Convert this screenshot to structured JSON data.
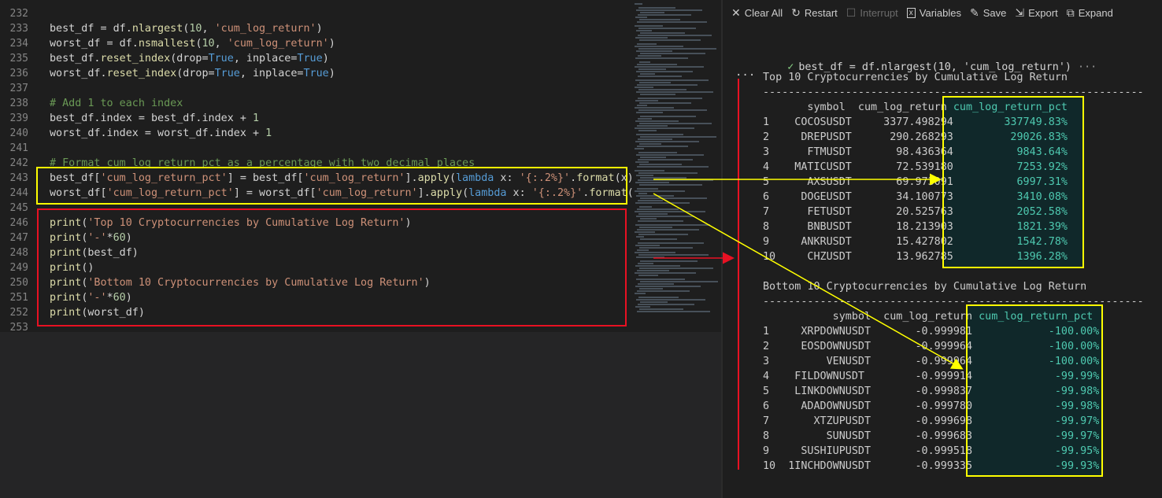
{
  "editor": {
    "line_numbers": [
      "232",
      "233",
      "234",
      "235",
      "236",
      "237",
      "238",
      "239",
      "240",
      "241",
      "242",
      "243",
      "244",
      "245",
      "246",
      "247",
      "248",
      "249",
      "250",
      "251",
      "252",
      "253"
    ],
    "lines": [
      [],
      [
        {
          "t": "best_df = df.",
          "c": ""
        },
        {
          "t": "nlargest",
          "c": "fn"
        },
        {
          "t": "(",
          "c": ""
        },
        {
          "t": "10",
          "c": "num"
        },
        {
          "t": ", ",
          "c": ""
        },
        {
          "t": "'cum_log_return'",
          "c": "str"
        },
        {
          "t": ")",
          "c": ""
        }
      ],
      [
        {
          "t": "worst_df = df.",
          "c": ""
        },
        {
          "t": "nsmallest",
          "c": "fn"
        },
        {
          "t": "(",
          "c": ""
        },
        {
          "t": "10",
          "c": "num"
        },
        {
          "t": ", ",
          "c": ""
        },
        {
          "t": "'cum_log_return'",
          "c": "str"
        },
        {
          "t": ")",
          "c": ""
        }
      ],
      [
        {
          "t": "best_df.",
          "c": ""
        },
        {
          "t": "reset_index",
          "c": "fn"
        },
        {
          "t": "(drop=",
          "c": ""
        },
        {
          "t": "True",
          "c": "kw"
        },
        {
          "t": ", inplace=",
          "c": ""
        },
        {
          "t": "True",
          "c": "kw"
        },
        {
          "t": ")",
          "c": ""
        }
      ],
      [
        {
          "t": "worst_df.",
          "c": ""
        },
        {
          "t": "reset_index",
          "c": "fn"
        },
        {
          "t": "(drop=",
          "c": ""
        },
        {
          "t": "True",
          "c": "kw"
        },
        {
          "t": ", inplace=",
          "c": ""
        },
        {
          "t": "True",
          "c": "kw"
        },
        {
          "t": ")",
          "c": ""
        }
      ],
      [],
      [
        {
          "t": "# Add 1 to each index",
          "c": "cm"
        }
      ],
      [
        {
          "t": "best_df.index = best_df.index + ",
          "c": ""
        },
        {
          "t": "1",
          "c": "num"
        }
      ],
      [
        {
          "t": "worst_df.index = worst_df.index + ",
          "c": ""
        },
        {
          "t": "1",
          "c": "num"
        }
      ],
      [],
      [
        {
          "t": "# Format cum_log_return_pct as a percentage with two decimal places",
          "c": "cm"
        }
      ],
      [
        {
          "t": "best_df[",
          "c": ""
        },
        {
          "t": "'cum_log_return_pct'",
          "c": "str"
        },
        {
          "t": "] = best_df[",
          "c": ""
        },
        {
          "t": "'cum_log_return'",
          "c": "str"
        },
        {
          "t": "].",
          "c": ""
        },
        {
          "t": "apply",
          "c": "fn"
        },
        {
          "t": "(",
          "c": ""
        },
        {
          "t": "lambda",
          "c": "kw"
        },
        {
          "t": " x: ",
          "c": ""
        },
        {
          "t": "'{:.2%}'",
          "c": "str"
        },
        {
          "t": ".",
          "c": ""
        },
        {
          "t": "format",
          "c": "fn"
        },
        {
          "t": "(x))",
          "c": ""
        }
      ],
      [
        {
          "t": "worst_df[",
          "c": ""
        },
        {
          "t": "'cum_log_return_pct'",
          "c": "str"
        },
        {
          "t": "] = worst_df[",
          "c": ""
        },
        {
          "t": "'cum_log_return'",
          "c": "str"
        },
        {
          "t": "].",
          "c": ""
        },
        {
          "t": "apply",
          "c": "fn"
        },
        {
          "t": "(",
          "c": ""
        },
        {
          "t": "lambda",
          "c": "kw"
        },
        {
          "t": " x: ",
          "c": ""
        },
        {
          "t": "'{:.2%}'",
          "c": "str"
        },
        {
          "t": ".",
          "c": ""
        },
        {
          "t": "format",
          "c": "fn"
        },
        {
          "t": "(x))",
          "c": ""
        }
      ],
      [],
      [
        {
          "t": "print",
          "c": "fn"
        },
        {
          "t": "(",
          "c": ""
        },
        {
          "t": "'Top 10 Cryptocurrencies by Cumulative Log Return'",
          "c": "str"
        },
        {
          "t": ")",
          "c": ""
        }
      ],
      [
        {
          "t": "print",
          "c": "fn"
        },
        {
          "t": "(",
          "c": ""
        },
        {
          "t": "'-'",
          "c": "str"
        },
        {
          "t": "*",
          "c": ""
        },
        {
          "t": "60",
          "c": "num"
        },
        {
          "t": ")",
          "c": ""
        }
      ],
      [
        {
          "t": "print",
          "c": "fn"
        },
        {
          "t": "(best_df)",
          "c": ""
        }
      ],
      [
        {
          "t": "print",
          "c": "fn"
        },
        {
          "t": "()",
          "c": ""
        }
      ],
      [
        {
          "t": "print",
          "c": "fn"
        },
        {
          "t": "(",
          "c": ""
        },
        {
          "t": "'Bottom 10 Cryptocurrencies by Cumulative Log Return'",
          "c": "str"
        },
        {
          "t": ")",
          "c": ""
        }
      ],
      [
        {
          "t": "print",
          "c": "fn"
        },
        {
          "t": "(",
          "c": ""
        },
        {
          "t": "'-'",
          "c": "str"
        },
        {
          "t": "*",
          "c": ""
        },
        {
          "t": "60",
          "c": "num"
        },
        {
          "t": ")",
          "c": ""
        }
      ],
      [
        {
          "t": "print",
          "c": "fn"
        },
        {
          "t": "(worst_df)",
          "c": ""
        }
      ],
      []
    ]
  },
  "toolbar": {
    "clear_all": "Clear All",
    "restart": "Restart",
    "interrupt": "Interrupt",
    "variables": "Variables",
    "save": "Save",
    "export": "Export",
    "expand": "Expand"
  },
  "output": {
    "cell_code": "best_df = df.nlargest(10, 'cum_log_return')",
    "cell_more": "···",
    "collapse": "···",
    "top_title": "Top 10 Cryptocurrencies by Cumulative Log Return",
    "separator": "------------------------------------------------------------",
    "top_header": "       symbol  cum_log_return ",
    "top_pct_header": "cum_log_return_pct",
    "top_rows": [
      {
        "left": "1    COCOSUSDT     3377.498294 ",
        "pct": "       337749.83%"
      },
      {
        "left": "2     DREPUSDT      290.268293 ",
        "pct": "        29026.83%"
      },
      {
        "left": "3      FTMUSDT       98.436364 ",
        "pct": "         9843.64%"
      },
      {
        "left": "4    MATICUSDT       72.539180 ",
        "pct": "         7253.92%"
      },
      {
        "left": "5      AXSUSDT       69.973091 ",
        "pct": "         6997.31%"
      },
      {
        "left": "6     DOGEUSDT       34.100773 ",
        "pct": "         3410.08%"
      },
      {
        "left": "7      FETUSDT       20.525763 ",
        "pct": "         2052.58%"
      },
      {
        "left": "8      BNBUSDT       18.213903 ",
        "pct": "         1821.39%"
      },
      {
        "left": "9     ANKRUSDT       15.427802 ",
        "pct": "         1542.78%"
      },
      {
        "left": "10     CHZUSDT       13.962785 ",
        "pct": "         1396.28%"
      }
    ],
    "bottom_title": "Bottom 10 Cryptocurrencies by Cumulative Log Return",
    "bottom_header": "           symbol  cum_log_return ",
    "bottom_pct_header": "cum_log_return_pct",
    "bottom_rows": [
      {
        "left": "1     XRPDOWNUSDT       -0.999981 ",
        "pct": "           -100.00%"
      },
      {
        "left": "2     EOSDOWNUSDT       -0.999964 ",
        "pct": "           -100.00%"
      },
      {
        "left": "3         VENUSDT       -0.999964 ",
        "pct": "           -100.00%"
      },
      {
        "left": "4    FILDOWNUSDT        -0.999914 ",
        "pct": "            -99.99%"
      },
      {
        "left": "5    LINKDOWNUSDT       -0.999837 ",
        "pct": "            -99.98%"
      },
      {
        "left": "6     ADADOWNUSDT       -0.999780 ",
        "pct": "            -99.98%"
      },
      {
        "left": "7       XTZUPUSDT       -0.999698 ",
        "pct": "            -99.97%"
      },
      {
        "left": "8         SUNUSDT       -0.999683 ",
        "pct": "            -99.97%"
      },
      {
        "left": "9     SUSHIUPUSDT       -0.999518 ",
        "pct": "            -99.95%"
      },
      {
        "left": "10  1INCHDOWNUSDT       -0.999335 ",
        "pct": "            -99.93%"
      }
    ]
  },
  "colors": {
    "annotation_yellow": "#ffff00",
    "annotation_red": "#e81123",
    "teal": "#4ec9b0"
  }
}
